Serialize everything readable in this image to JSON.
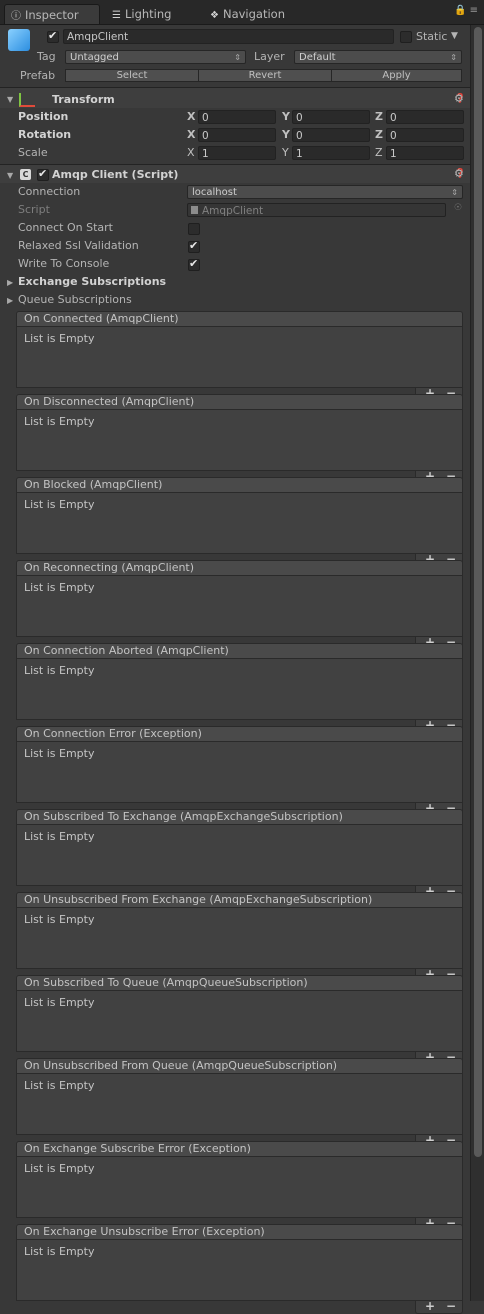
{
  "tabs": [
    {
      "label": "Inspector",
      "icon": "info-icon"
    },
    {
      "label": "Lighting",
      "icon": "lighting-icon"
    },
    {
      "label": "Navigation",
      "icon": "navigation-icon"
    }
  ],
  "gameobject": {
    "name": "AmqpClient",
    "active": true,
    "static_label": "Static",
    "tag_label": "Tag",
    "tag_value": "Untagged",
    "layer_label": "Layer",
    "layer_value": "Default",
    "prefab_label": "Prefab",
    "prefab_buttons": [
      "Select",
      "Revert",
      "Apply"
    ]
  },
  "transform": {
    "title": "Transform",
    "rows": [
      {
        "label": "Position",
        "x": "0",
        "y": "0",
        "z": "0"
      },
      {
        "label": "Rotation",
        "x": "0",
        "y": "0",
        "z": "0"
      },
      {
        "label": "Scale",
        "x": "1",
        "y": "1",
        "z": "1"
      }
    ],
    "axes": [
      "X",
      "Y",
      "Z"
    ]
  },
  "component": {
    "title": "Amqp Client (Script)",
    "connection_label": "Connection",
    "connection_value": "localhost",
    "script_label": "Script",
    "script_value": "AmqpClient",
    "connect_on_start_label": "Connect On Start",
    "connect_on_start": false,
    "relaxed_ssl_label": "Relaxed Ssl Validation",
    "relaxed_ssl": true,
    "write_console_label": "Write To Console",
    "write_console": true,
    "exchange_subs_label": "Exchange Subscriptions",
    "queue_subs_label": "Queue Subscriptions"
  },
  "events": [
    {
      "title": "On Connected (AmqpClient)",
      "body": "List is Empty"
    },
    {
      "title": "On Disconnected (AmqpClient)",
      "body": "List is Empty"
    },
    {
      "title": "On Blocked (AmqpClient)",
      "body": "List is Empty"
    },
    {
      "title": "On Reconnecting (AmqpClient)",
      "body": "List is Empty"
    },
    {
      "title": "On Connection Aborted (AmqpClient)",
      "body": "List is Empty"
    },
    {
      "title": "On Connection Error (Exception)",
      "body": "List is Empty"
    },
    {
      "title": "On Subscribed To Exchange (AmqpExchangeSubscription)",
      "body": "List is Empty"
    },
    {
      "title": "On Unsubscribed From Exchange (AmqpExchangeSubscription)",
      "body": "List is Empty"
    },
    {
      "title": "On Subscribed To Queue (AmqpQueueSubscription)",
      "body": "List is Empty"
    },
    {
      "title": "On Unsubscribed From Queue (AmqpQueueSubscription)",
      "body": "List is Empty"
    },
    {
      "title": "On Exchange Subscribe Error (Exception)",
      "body": "List is Empty"
    },
    {
      "title": "On Exchange Unsubscribe Error (Exception)",
      "body": "List is Empty"
    }
  ],
  "event_buttons": {
    "add": "+",
    "remove": "−"
  }
}
